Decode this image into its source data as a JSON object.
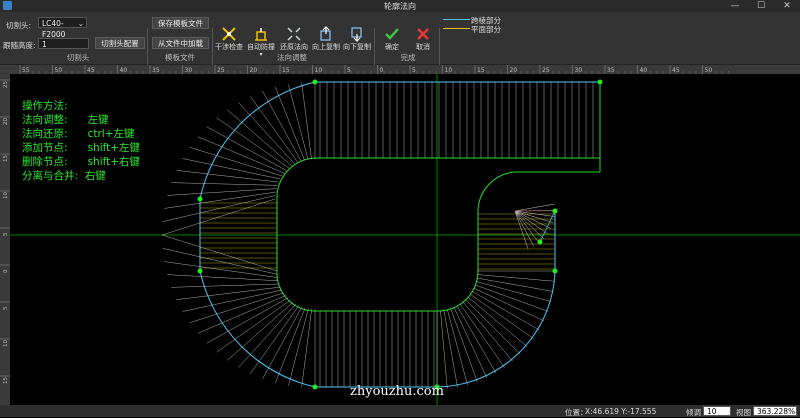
{
  "window": {
    "title": "轮廓法向",
    "minimize": "—",
    "maximize": "☐",
    "close": "✕"
  },
  "ribbon": {
    "cutter_head_label": "切割头:",
    "cutter_head_value": "LC40-F2000",
    "follow_height_label": "跟随高度:",
    "follow_height_value": "1",
    "cutter_config_button": "切割头配置",
    "save_template_button": "保存模板文件",
    "load_from_file_button": "从文件中加载",
    "groups": {
      "cutter_head": "切割头",
      "template_file": "模板文件",
      "normal_adjust": "法向调整",
      "finish": "完成"
    },
    "tools": [
      {
        "name": "interference-check",
        "label": "干涉检查"
      },
      {
        "name": "auto-avoid",
        "label": "自动防撞"
      },
      {
        "name": "restore-normal",
        "label": "还原法向"
      },
      {
        "name": "copy-up",
        "label": "向上复制"
      },
      {
        "name": "copy-down",
        "label": "向下复制"
      },
      {
        "name": "confirm",
        "label": "确定"
      },
      {
        "name": "cancel",
        "label": "取消"
      }
    ],
    "legend": [
      {
        "label": "跨棱部分",
        "color": "#4fc3f7"
      },
      {
        "label": "平面部分",
        "color": "#f0c000"
      }
    ]
  },
  "rulers": {
    "h_ticks": [
      "55",
      "50",
      "45",
      "40",
      "35",
      "30",
      "25",
      "20",
      "15",
      "10",
      "5",
      "0",
      "5",
      "10",
      "15",
      "20",
      "25",
      "30",
      "35",
      "40",
      "45",
      "50"
    ],
    "v_ticks": [
      "25",
      "20",
      "15",
      "10",
      "5",
      "0",
      "5",
      "10",
      "15",
      "20"
    ]
  },
  "instructions": [
    "操作方法:",
    "法向调整:      左键",
    "法向还原:      ctrl+左键",
    "添加节点:      shift+左键",
    "删除节点:      shift+右键",
    "分离与合并:  右键"
  ],
  "status": {
    "position_label": "位置：",
    "position_value": "X:46.619 Y:-17.555",
    "tilt_label": "倾调",
    "tilt_value": "10",
    "view_label": "视图",
    "view_value": "363.228%"
  },
  "watermark": "zhyouzhu.com",
  "colors": {
    "contour_cyan": "#4fc3f7",
    "contour_green": "#22dd22",
    "normal_yellow": "#e0c800",
    "normal_white": "#d0d0d0",
    "axis": "#00aa00",
    "node": "#22ee22",
    "dashed": "#c8102e"
  }
}
